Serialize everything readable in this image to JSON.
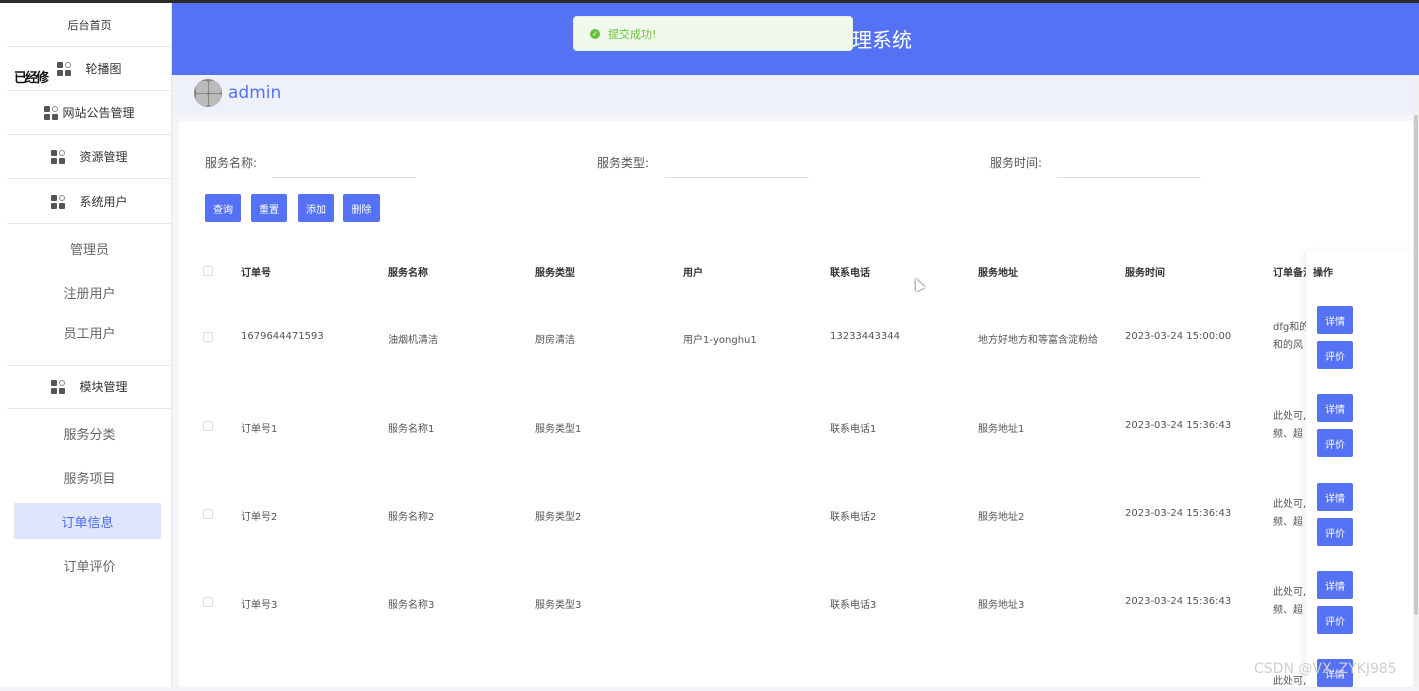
{
  "header": {
    "title": "理系统"
  },
  "toast": {
    "text": "提交成功!",
    "icon": "check-circle-icon"
  },
  "user": {
    "name": "admin"
  },
  "sidebar": {
    "overlap_text": "已经修",
    "items": [
      {
        "label": "后台首页",
        "icon": ""
      },
      {
        "label": "轮播图",
        "icon": "grid-icon"
      },
      {
        "label": "网站公告管理",
        "icon": "grid-icon"
      },
      {
        "label": "资源管理",
        "icon": "grid-icon"
      },
      {
        "label": "系统用户",
        "icon": "grid-icon"
      },
      {
        "label": "管理员",
        "icon": ""
      },
      {
        "label": "注册用户",
        "icon": ""
      },
      {
        "label": "员工用户",
        "icon": ""
      },
      {
        "label": "模块管理",
        "icon": "grid-icon"
      },
      {
        "label": "服务分类",
        "icon": ""
      },
      {
        "label": "服务项目",
        "icon": ""
      },
      {
        "label": "订单信息",
        "icon": ""
      },
      {
        "label": "订单评价",
        "icon": ""
      }
    ],
    "active": "订单信息"
  },
  "search": {
    "name_label": "服务名称:",
    "type_label": "服务类型:",
    "time_label": "服务时间:",
    "name_value": "",
    "type_value": "",
    "time_value": ""
  },
  "buttons": {
    "query": "查询",
    "reset": "重置",
    "add": "添加",
    "delete": "删除"
  },
  "table": {
    "columns": [
      "订单号",
      "服务名称",
      "服务类型",
      "用户",
      "联系电话",
      "服务地址",
      "服务时间",
      "订单备注",
      "操作"
    ],
    "rows": [
      {
        "order": "1679644471593",
        "name": "油烟机清洁",
        "type": "厨房清洁",
        "user": "用户1-yonghu1",
        "phone": "13233443344",
        "address": "地方好地方和等富含淀粉给",
        "time": "2023-03-24 15:00:00",
        "remark1": "dfg和的",
        "remark2": "和的风"
      },
      {
        "order": "订单号1",
        "name": "服务名称1",
        "type": "服务类型1",
        "user": "",
        "phone": "联系电话1",
        "address": "服务地址1",
        "time": "2023-03-24 15:36:43",
        "remark1": "此处可,",
        "remark2": "频、超"
      },
      {
        "order": "订单号2",
        "name": "服务名称2",
        "type": "服务类型2",
        "user": "",
        "phone": "联系电话2",
        "address": "服务地址2",
        "time": "2023-03-24 15:36:43",
        "remark1": "此处可,",
        "remark2": "频、超"
      },
      {
        "order": "订单号3",
        "name": "服务名称3",
        "type": "服务类型3",
        "user": "",
        "phone": "联系电话3",
        "address": "服务地址3",
        "time": "2023-03-24 15:36:43",
        "remark1": "此处可,",
        "remark2": "频、超"
      }
    ],
    "row_buttons": {
      "detail": "详情",
      "review": "评价"
    },
    "partial_last_remark": "此处可,"
  },
  "watermark": "CSDN @VX_ZYKJ985",
  "colors": {
    "primary": "#5572f5",
    "success": "#67c23a",
    "active_bg": "#dfe5fb"
  }
}
